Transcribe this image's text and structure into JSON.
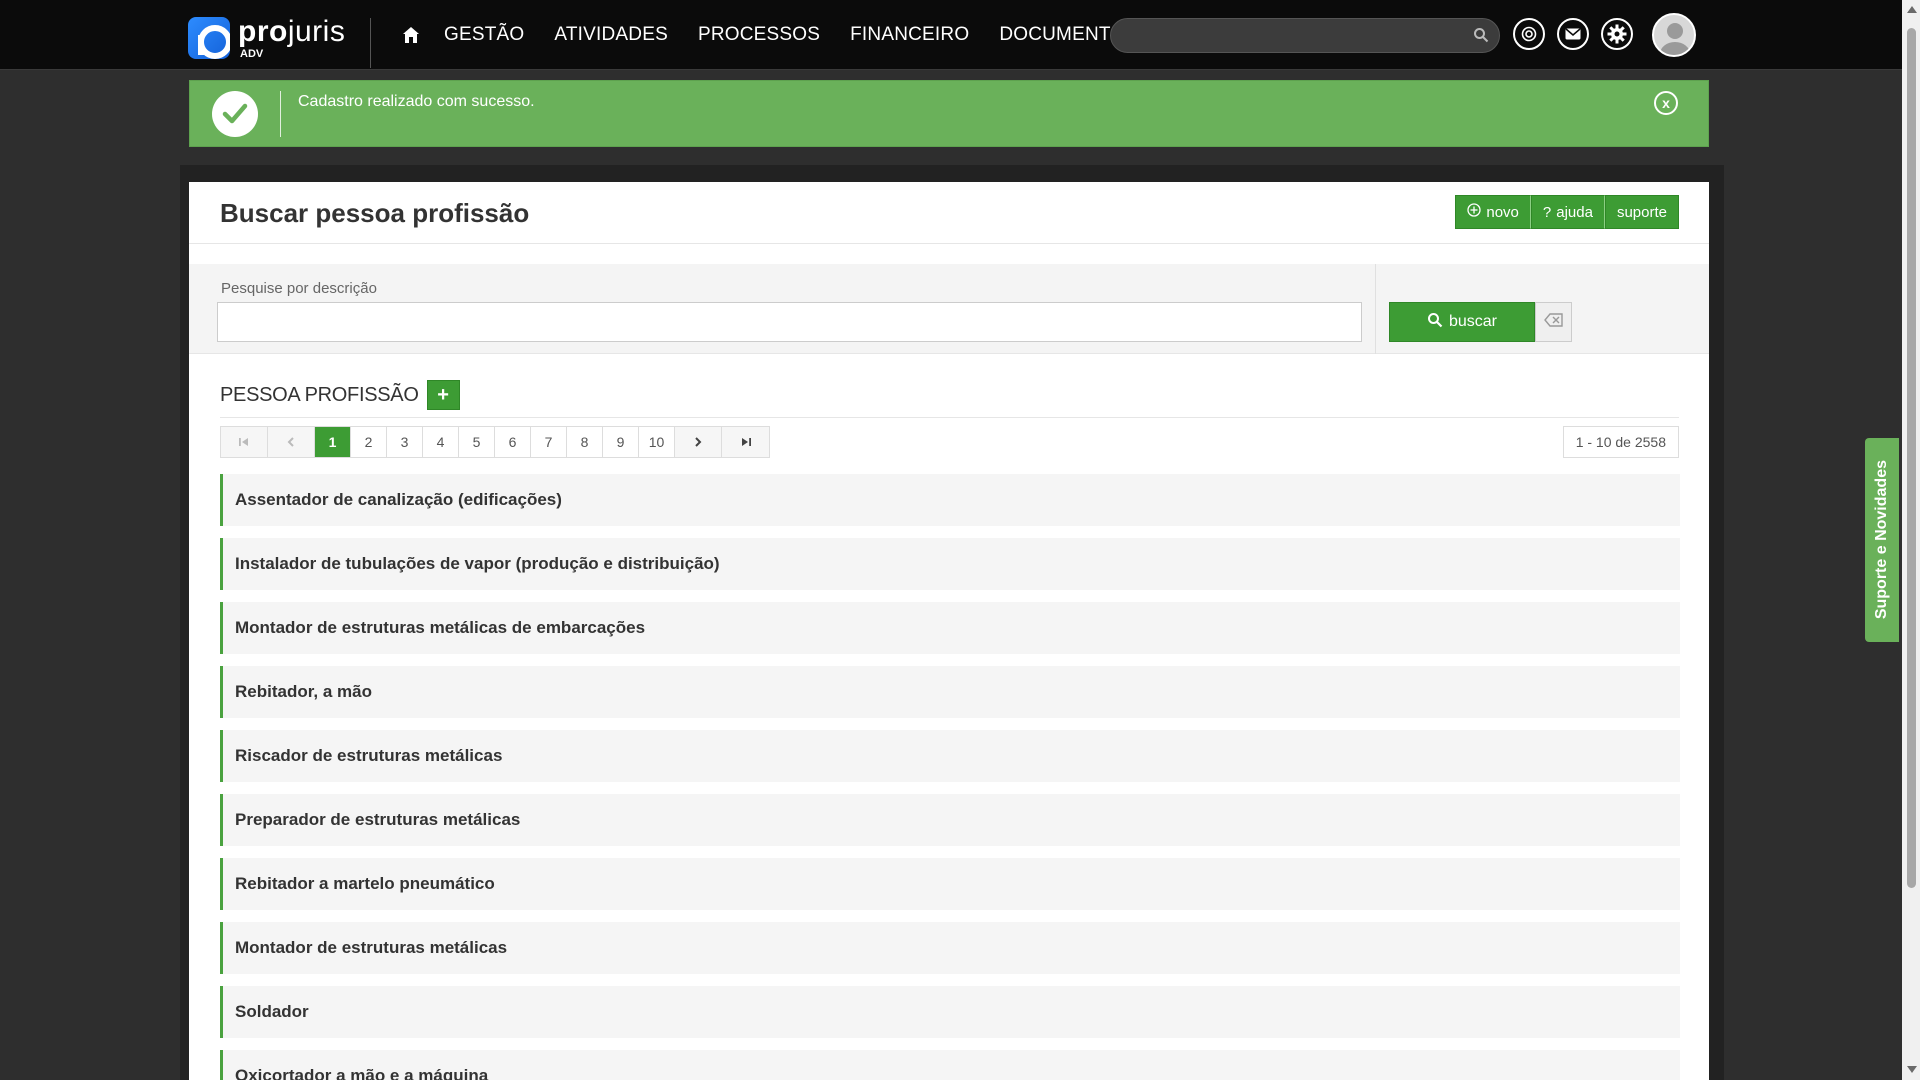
{
  "app": {
    "logo_name_bold": "pro",
    "logo_name_thin": "juris",
    "logo_sub": "ADV"
  },
  "nav": {
    "items": [
      {
        "label": "GESTÃO"
      },
      {
        "label": "ATIVIDADES"
      },
      {
        "label": "PROCESSOS"
      },
      {
        "label": "FINANCEIRO"
      },
      {
        "label": "DOCUMENTOS"
      }
    ],
    "search_value": "",
    "icons": [
      "home-icon",
      "search-icon",
      "openai-icon",
      "mail-icon",
      "gear-icon",
      "avatar"
    ]
  },
  "alert": {
    "message": "Cadastro realizado com sucesso.",
    "close_label": "x"
  },
  "page": {
    "title": "Buscar pessoa profissão",
    "buttons": {
      "new_label": "novo",
      "help_label": "ajuda",
      "support_label": "suporte"
    }
  },
  "filter": {
    "label": "Pesquise por descrição",
    "value": "",
    "search_button_label": "buscar"
  },
  "section": {
    "title": "PESSOA PROFISSÃO",
    "add_label": "+"
  },
  "pagination": {
    "pages": [
      "1",
      "2",
      "3",
      "4",
      "5",
      "6",
      "7",
      "8",
      "9",
      "10"
    ],
    "current_page": "1",
    "range_text": "1 - 10 de 2558"
  },
  "list": {
    "items": [
      "Assentador de canalização (edificações)",
      "Instalador de tubulações de vapor (produção e distribuição)",
      "Montador de estruturas metálicas de embarcações",
      "Rebitador, a mão",
      "Riscador de estruturas metálicas",
      "Preparador de estruturas metálicas",
      "Rebitador a martelo pneumático",
      "Montador de estruturas metálicas",
      "Soldador",
      "Oxicortador a mão e a máquina"
    ]
  },
  "side_tab": {
    "label": "Suporte e Novidades"
  },
  "colors": {
    "accent_green": "#3d9c34",
    "alert_green": "#6ab15a",
    "topbar": "#0b0b0b"
  }
}
